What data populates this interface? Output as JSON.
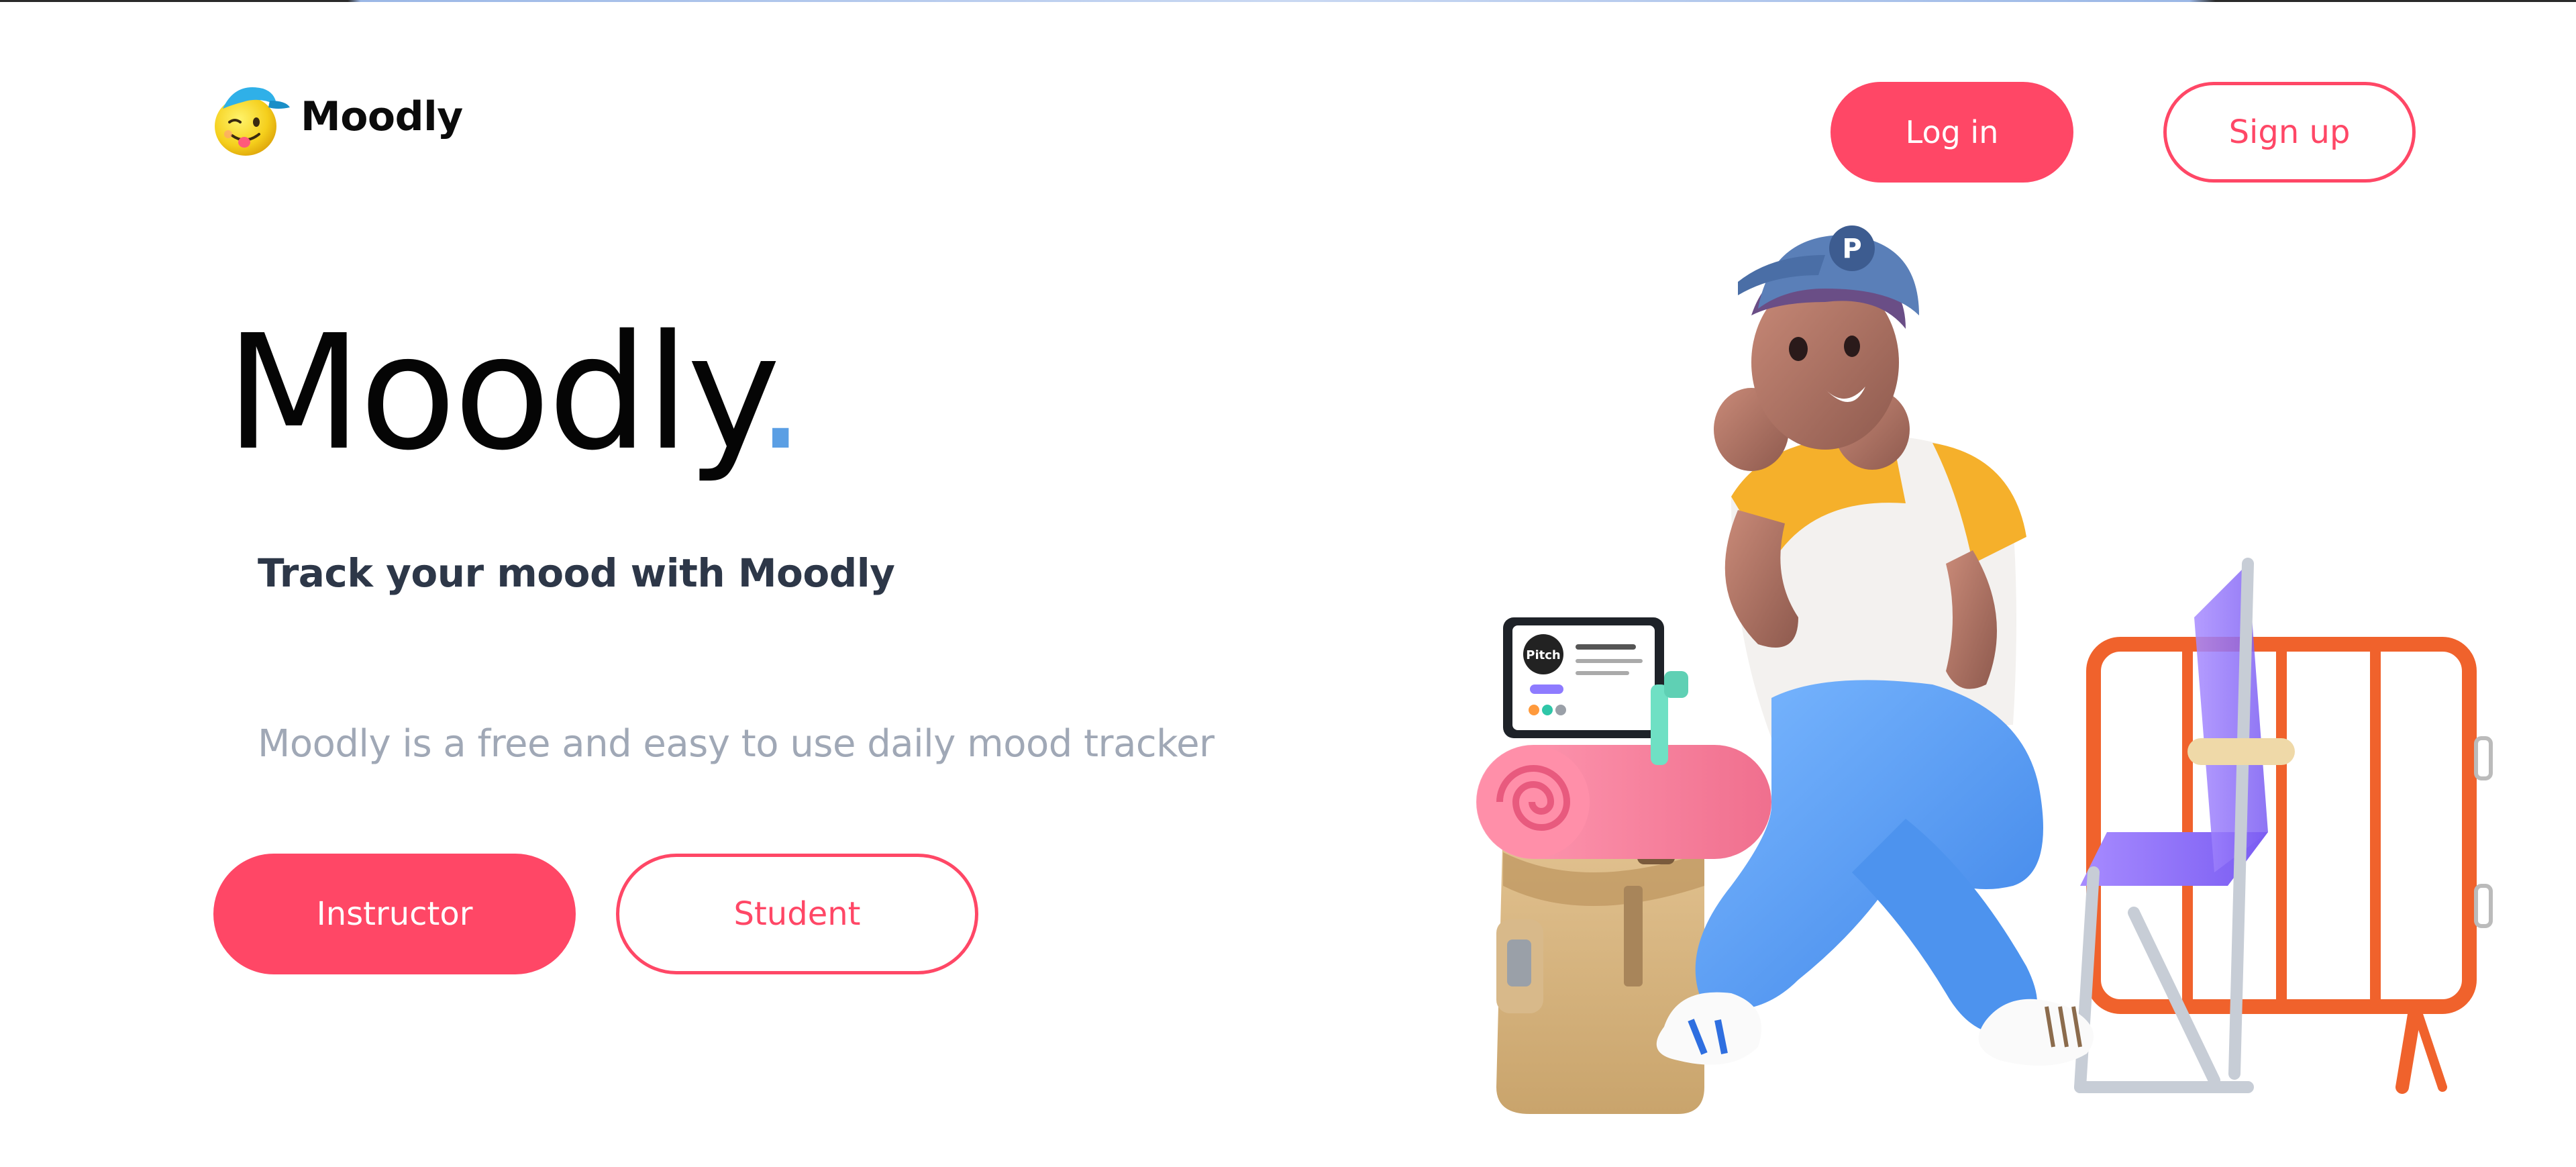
{
  "header": {
    "brand_name": "Moodly",
    "login_label": "Log in",
    "signup_label": "Sign up"
  },
  "hero": {
    "title": "Moodly",
    "title_dot": ".",
    "tagline": "Track your mood with Moodly",
    "description": "Moodly is a free and easy to use daily mood tracker",
    "instructor_label": "Instructor",
    "student_label": "Student"
  },
  "illustration": {
    "laptop_brand": "Pitch",
    "cap_letter": "P"
  },
  "colors": {
    "accent": "#ff4766",
    "title_dot": "#5b9fe4",
    "tagline": "#2d3748",
    "description": "#a0a8b6"
  },
  "icons": {
    "logo": "winking-emoji-cap-icon"
  }
}
